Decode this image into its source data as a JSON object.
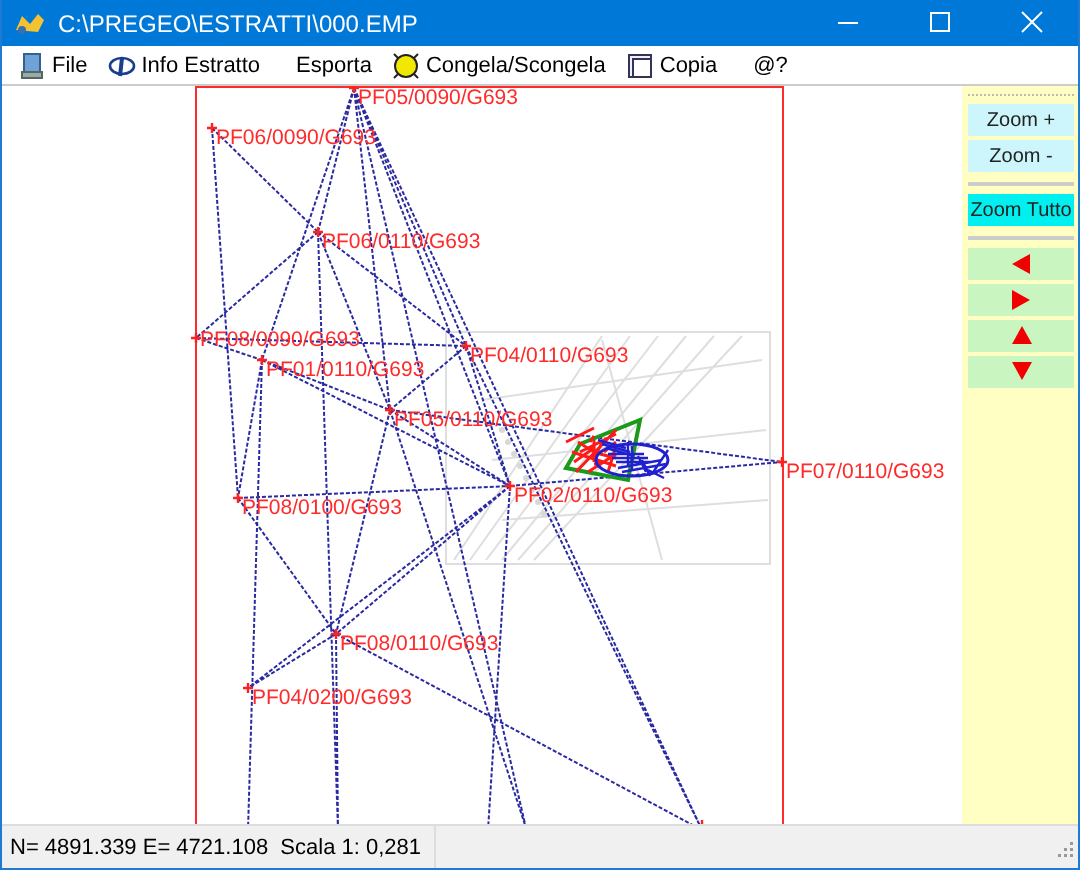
{
  "window": {
    "title": "C:\\PREGEO\\ESTRATTI\\000.EMP"
  },
  "menu": [
    {
      "label": "File",
      "kind": "file"
    },
    {
      "label": "Info Estratto",
      "kind": "info"
    },
    {
      "label": "Esporta",
      "kind": "plain"
    },
    {
      "label": "Congela/Scongela",
      "kind": "freeze"
    },
    {
      "label": "Copia",
      "kind": "copy"
    },
    {
      "label": "@?",
      "kind": "plain"
    }
  ],
  "points": [
    {
      "label": "PF05/0090/G693"
    },
    {
      "label": "PF06/0090/G693"
    },
    {
      "label": "PF06/0110/G693"
    },
    {
      "label": "PF08/0090/G693"
    },
    {
      "label": "PF01/0110/G693"
    },
    {
      "label": "PF04/0110/G693"
    },
    {
      "label": "PF05/0110/G693"
    },
    {
      "label": "PF02/0110/G693"
    },
    {
      "label": "PF08/0100/G693"
    },
    {
      "label": "PF07/0110/G693"
    },
    {
      "label": "PF08/0110/G693"
    },
    {
      "label": "PF04/0200/G693"
    }
  ],
  "zoom_buttons": [
    {
      "label": "Zoom +",
      "selected": false
    },
    {
      "label": "Zoom -",
      "selected": false
    },
    {
      "label": "Zoom Tutto",
      "selected": true
    }
  ],
  "pan_buttons": [
    {
      "kind": "left"
    },
    {
      "kind": "right"
    },
    {
      "kind": "up"
    },
    {
      "kind": "down"
    }
  ],
  "status_bar": {
    "text": "N= 4891.339 E= 4721.108  Scala 1: 0,281"
  }
}
